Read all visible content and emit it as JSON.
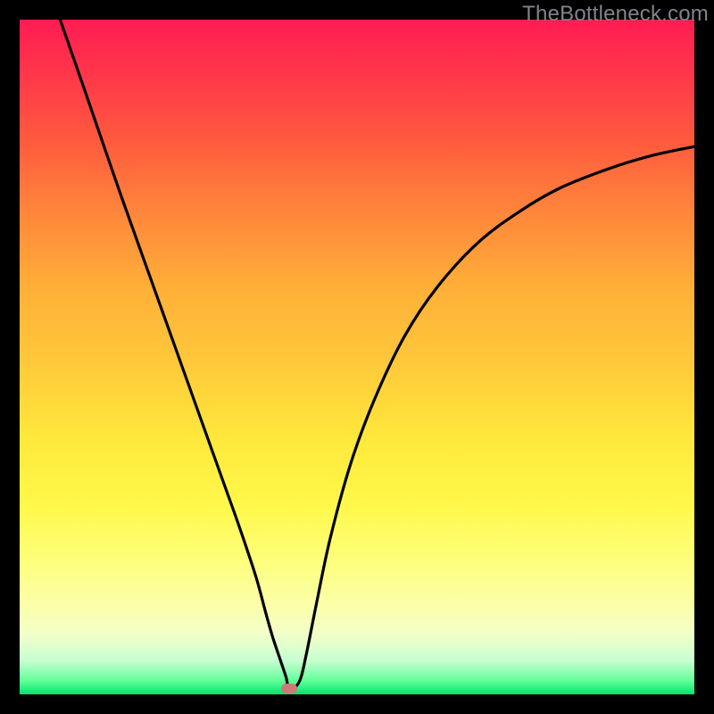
{
  "watermark": "TheBottleneck.com",
  "marker": {
    "x_frac": 0.4,
    "y_frac": 0.992
  },
  "chart_data": {
    "type": "line",
    "title": "",
    "xlabel": "",
    "ylabel": "",
    "xlim": [
      0,
      1
    ],
    "ylim": [
      0,
      1
    ],
    "series": [
      {
        "name": "curve",
        "x": [
          0.06,
          0.1,
          0.15,
          0.2,
          0.25,
          0.3,
          0.325,
          0.35,
          0.365,
          0.375,
          0.385,
          0.395,
          0.4,
          0.415,
          0.425,
          0.44,
          0.46,
          0.49,
          0.525,
          0.57,
          0.62,
          0.68,
          0.74,
          0.8,
          0.87,
          0.935,
          1.0
        ],
        "y": [
          1.0,
          0.885,
          0.74,
          0.6,
          0.46,
          0.32,
          0.25,
          0.175,
          0.12,
          0.085,
          0.055,
          0.025,
          0.006,
          0.02,
          0.06,
          0.135,
          0.23,
          0.34,
          0.435,
          0.53,
          0.605,
          0.67,
          0.715,
          0.75,
          0.778,
          0.798,
          0.812
        ]
      }
    ],
    "marker_point": {
      "x": 0.4,
      "y": 0.008
    },
    "background_gradient": {
      "top": "#ff1c52",
      "mid": "#ffe83b",
      "bottom": "#00e46e"
    }
  }
}
